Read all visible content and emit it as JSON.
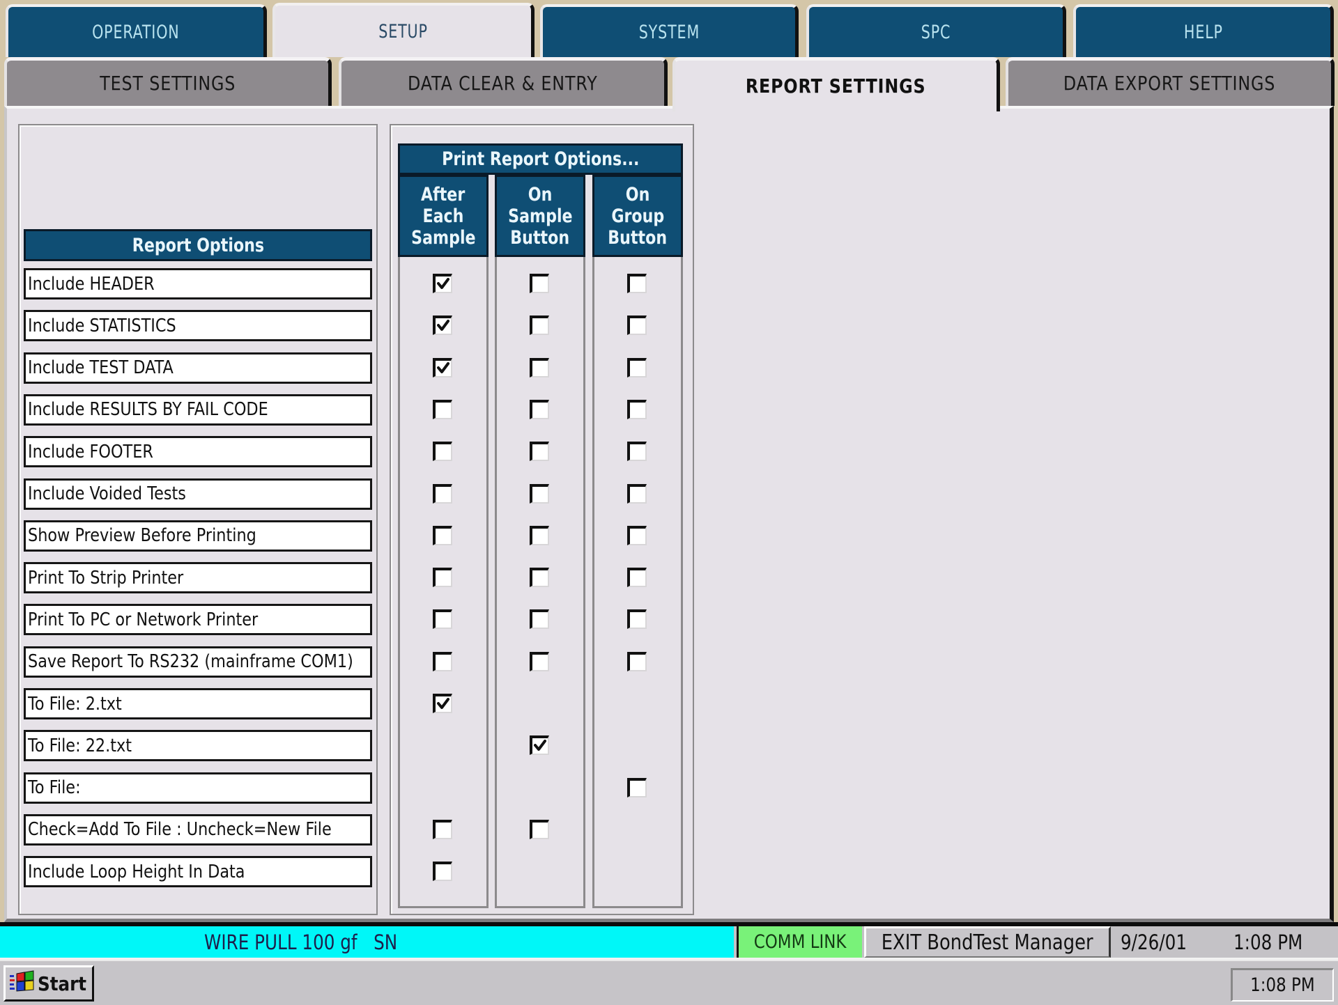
{
  "top_tabs": [
    {
      "label": "OPERATION",
      "active": false
    },
    {
      "label": "SETUP",
      "active": true
    },
    {
      "label": "SYSTEM",
      "active": false
    },
    {
      "label": "SPC",
      "active": false
    },
    {
      "label": "HELP",
      "active": false
    }
  ],
  "sub_tabs": [
    {
      "label": "TEST SETTINGS",
      "active": false
    },
    {
      "label": "DATA CLEAR & ENTRY",
      "active": false
    },
    {
      "label": "REPORT SETTINGS",
      "active": true
    },
    {
      "label": "DATA EXPORT SETTINGS",
      "active": false
    }
  ],
  "report_options": {
    "header": "Report Options",
    "items": [
      {
        "label": "Include HEADER",
        "after_each_sample": true,
        "on_sample_button": false,
        "on_group_button": false
      },
      {
        "label": "Include STATISTICS",
        "after_each_sample": true,
        "on_sample_button": false,
        "on_group_button": false
      },
      {
        "label": "Include TEST DATA",
        "after_each_sample": true,
        "on_sample_button": false,
        "on_group_button": false
      },
      {
        "label": "Include RESULTS BY FAIL CODE",
        "after_each_sample": false,
        "on_sample_button": false,
        "on_group_button": false
      },
      {
        "label": "Include FOOTER",
        "after_each_sample": false,
        "on_sample_button": false,
        "on_group_button": false
      },
      {
        "label": "Include Voided Tests",
        "after_each_sample": false,
        "on_sample_button": false,
        "on_group_button": false
      },
      {
        "label": "Show Preview Before Printing",
        "after_each_sample": false,
        "on_sample_button": false,
        "on_group_button": false
      },
      {
        "label": "Print To Strip Printer",
        "after_each_sample": false,
        "on_sample_button": false,
        "on_group_button": false
      },
      {
        "label": "Print To PC or Network Printer",
        "after_each_sample": false,
        "on_sample_button": false,
        "on_group_button": false
      },
      {
        "label": "Save Report To RS232 (mainframe COM1)",
        "after_each_sample": false,
        "on_sample_button": false,
        "on_group_button": false
      },
      {
        "label": "To File: 2.txt",
        "after_each_sample": true,
        "on_sample_button": null,
        "on_group_button": null
      },
      {
        "label": "To File: 22.txt",
        "after_each_sample": null,
        "on_sample_button": true,
        "on_group_button": null
      },
      {
        "label": "To File:",
        "after_each_sample": null,
        "on_sample_button": null,
        "on_group_button": false
      },
      {
        "label": "Check=Add To File : Uncheck=New File",
        "after_each_sample": false,
        "on_sample_button": false,
        "on_group_button": null
      },
      {
        "label": "Include Loop Height In Data",
        "after_each_sample": false,
        "on_sample_button": null,
        "on_group_button": null
      }
    ]
  },
  "print_report_options": {
    "header": "Print Report Options...",
    "columns": [
      {
        "key": "after_each_sample",
        "lines": [
          "After",
          "Each",
          "Sample"
        ]
      },
      {
        "key": "on_sample_button",
        "lines": [
          "On",
          "Sample",
          "Button"
        ]
      },
      {
        "key": "on_group_button",
        "lines": [
          "On",
          "Group",
          "Button"
        ]
      }
    ]
  },
  "status_bar": {
    "title": "WIRE PULL 100 gf   SN",
    "comm_link": "COMM LINK",
    "exit_button": "EXIT BondTest Manager",
    "date": "9/26/01",
    "time": "1:08 PM"
  },
  "taskbar": {
    "start_label": "Start",
    "clock": "1:08 PM"
  },
  "colors": {
    "tab_blue": "#0f4e74",
    "tab_gray": "#8e8a8e",
    "panel_bg": "#e6e2e8",
    "status_cyan": "#00f7f8",
    "comm_link_green": "#79f279"
  }
}
